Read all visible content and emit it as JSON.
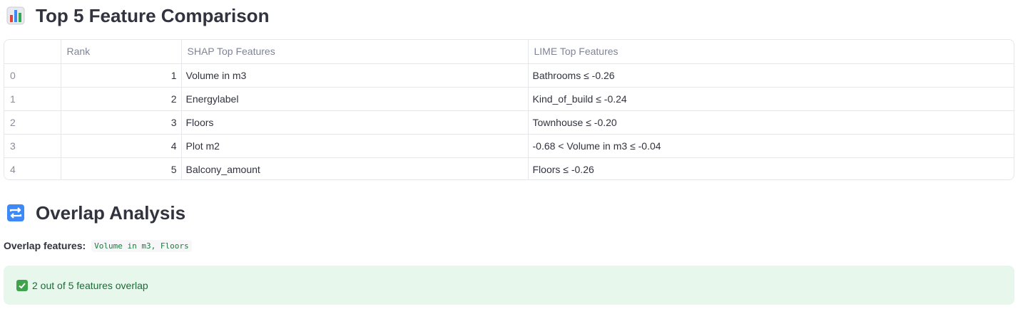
{
  "section1": {
    "title": "Top 5 Feature Comparison",
    "icon": "bar-chart-icon"
  },
  "table": {
    "headers": [
      "",
      "Rank",
      "SHAP Top Features",
      "LIME Top Features"
    ],
    "rows": [
      {
        "index": "0",
        "rank": "1",
        "shap": "Volume in m3",
        "lime": "Bathrooms ≤ -0.26"
      },
      {
        "index": "1",
        "rank": "2",
        "shap": "Energylabel",
        "lime": "Kind_of_build ≤ -0.24"
      },
      {
        "index": "2",
        "rank": "3",
        "shap": "Floors",
        "lime": "Townhouse ≤ -0.20"
      },
      {
        "index": "3",
        "rank": "4",
        "shap": "Plot m2",
        "lime": "-0.68 < Volume in m3 ≤ -0.04"
      },
      {
        "index": "4",
        "rank": "5",
        "shap": "Balcony_amount",
        "lime": "Floors ≤ -0.26"
      }
    ]
  },
  "section2": {
    "title": "Overlap Analysis",
    "icon": "repeat-arrows-icon"
  },
  "overlap": {
    "label": "Overlap features:",
    "value": "Volume in m3, Floors"
  },
  "alert": {
    "text": "2 out of 5 features overlap",
    "icon": "check-icon",
    "color": "#e8f7ec"
  }
}
